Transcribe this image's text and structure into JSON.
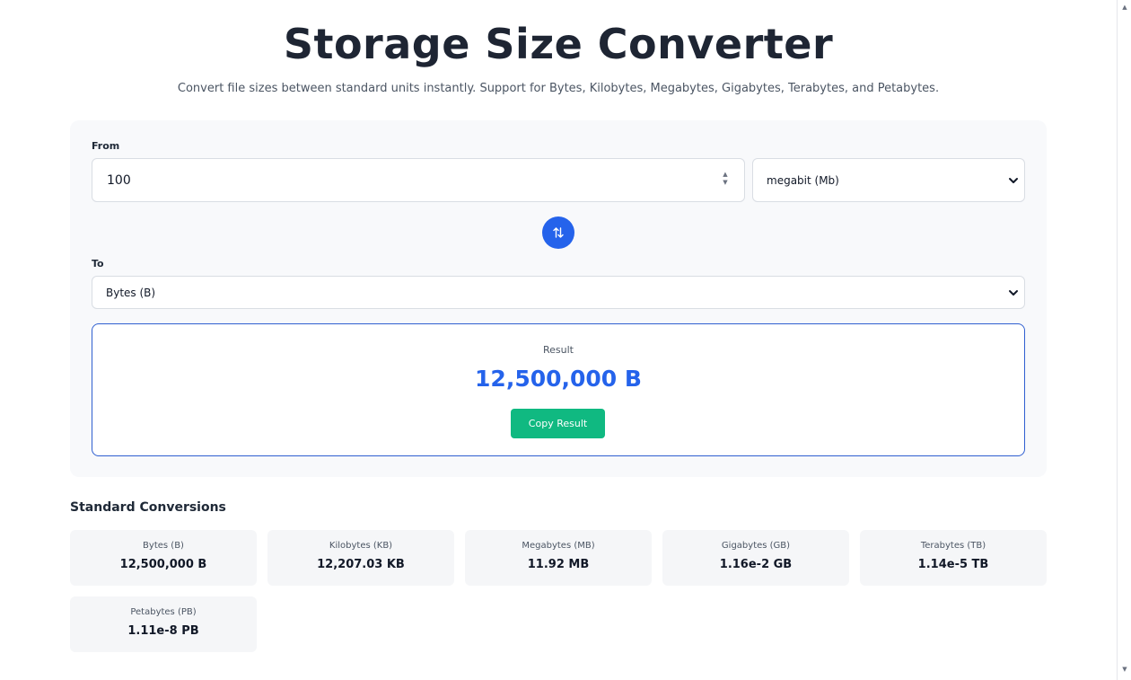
{
  "header": {
    "title": "Storage Size Converter",
    "subtitle": "Convert file sizes between standard units instantly. Support for Bytes, Kilobytes, Megabytes, Gigabytes, Terabytes, and Petabytes."
  },
  "converter": {
    "from_label": "From",
    "amount_value": "100",
    "from_unit": "megabit (Mb)",
    "to_label": "To",
    "to_unit": "Bytes (B)",
    "result_label": "Result",
    "result_value": "12,500,000 B",
    "copy_label": "Copy Result"
  },
  "standard": {
    "title": "Standard Conversions",
    "items": [
      {
        "unit": "Bytes (B)",
        "value": "12,500,000 B"
      },
      {
        "unit": "Kilobytes (KB)",
        "value": "12,207.03 KB"
      },
      {
        "unit": "Megabytes (MB)",
        "value": "11.92 MB"
      },
      {
        "unit": "Gigabytes (GB)",
        "value": "1.16e-2 GB"
      },
      {
        "unit": "Terabytes (TB)",
        "value": "1.14e-5 TB"
      },
      {
        "unit": "Petabytes (PB)",
        "value": "1.11e-8 PB"
      }
    ]
  },
  "colors": {
    "accent": "#2563eb",
    "copy_button": "#10b981",
    "title": "#1e2533"
  },
  "icons": {
    "swap": "swap-vertical-icon",
    "select": "chevron-down-icon",
    "spinner": "spinner-icon"
  }
}
